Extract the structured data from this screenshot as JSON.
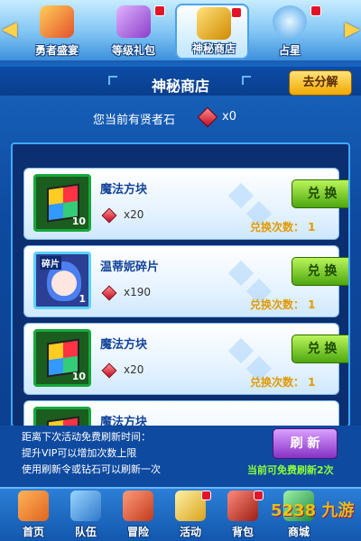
{
  "top_tabs": [
    {
      "label": "勇者盛宴",
      "icon": "feast-icon",
      "color": "#f5a623",
      "badge": false
    },
    {
      "label": "等级礼包",
      "icon": "gift-icon",
      "color": "#9b59d0",
      "badge": true
    },
    {
      "label": "神秘商店",
      "icon": "mystery-box-icon",
      "color": "#f0b400",
      "badge": true,
      "active": true
    },
    {
      "label": "占星",
      "icon": "crystal-ball-icon",
      "color": "#4aa3ea",
      "badge": true
    }
  ],
  "title": "神秘商店",
  "decompose_label": "去分解",
  "stones": {
    "label": "您当前有贤者石",
    "count": "x0"
  },
  "items": [
    {
      "name": "魔法方块",
      "qty": "10",
      "price": "x20",
      "button": "兑 换",
      "exchange": "兑换次数：  1",
      "kind": "cube"
    },
    {
      "name": "温蒂妮碎片",
      "qty": "1",
      "price": "x190",
      "button": "兑 换",
      "exchange": "兑换次数：  1",
      "kind": "fragment",
      "tag": "碎片"
    },
    {
      "name": "魔法方块",
      "qty": "10",
      "price": "x20",
      "button": "兑 换",
      "exchange": "兑换次数：  1",
      "kind": "cube"
    },
    {
      "name": "魔法方块",
      "qty": "",
      "price": "",
      "button": "",
      "exchange": "",
      "kind": "cube"
    }
  ],
  "info_lines": [
    "距离下次活动免费刷新时间：",
    "提升VIP可以增加次数上限",
    "使用刷新令或钻石可以刷新一次"
  ],
  "refresh_label": "刷 新",
  "free_refresh": "当前可免费刷新2次",
  "bottom_nav": [
    {
      "label": "首页",
      "icon": "home-icon",
      "color": "#f08a2a",
      "badge": false
    },
    {
      "label": "队伍",
      "icon": "team-icon",
      "color": "#4aa3ea",
      "badge": false
    },
    {
      "label": "冒险",
      "icon": "adventure-icon",
      "color": "#e35b3d",
      "badge": false
    },
    {
      "label": "活动",
      "icon": "events-scroll-icon",
      "color": "#f4c542",
      "badge": true
    },
    {
      "label": "背包",
      "icon": "backpack-icon",
      "color": "#c0392b",
      "badge": true
    },
    {
      "label": "商城",
      "icon": "shop-icon",
      "color": "#27ae60",
      "badge": false
    }
  ],
  "watermark": "5238 九游"
}
